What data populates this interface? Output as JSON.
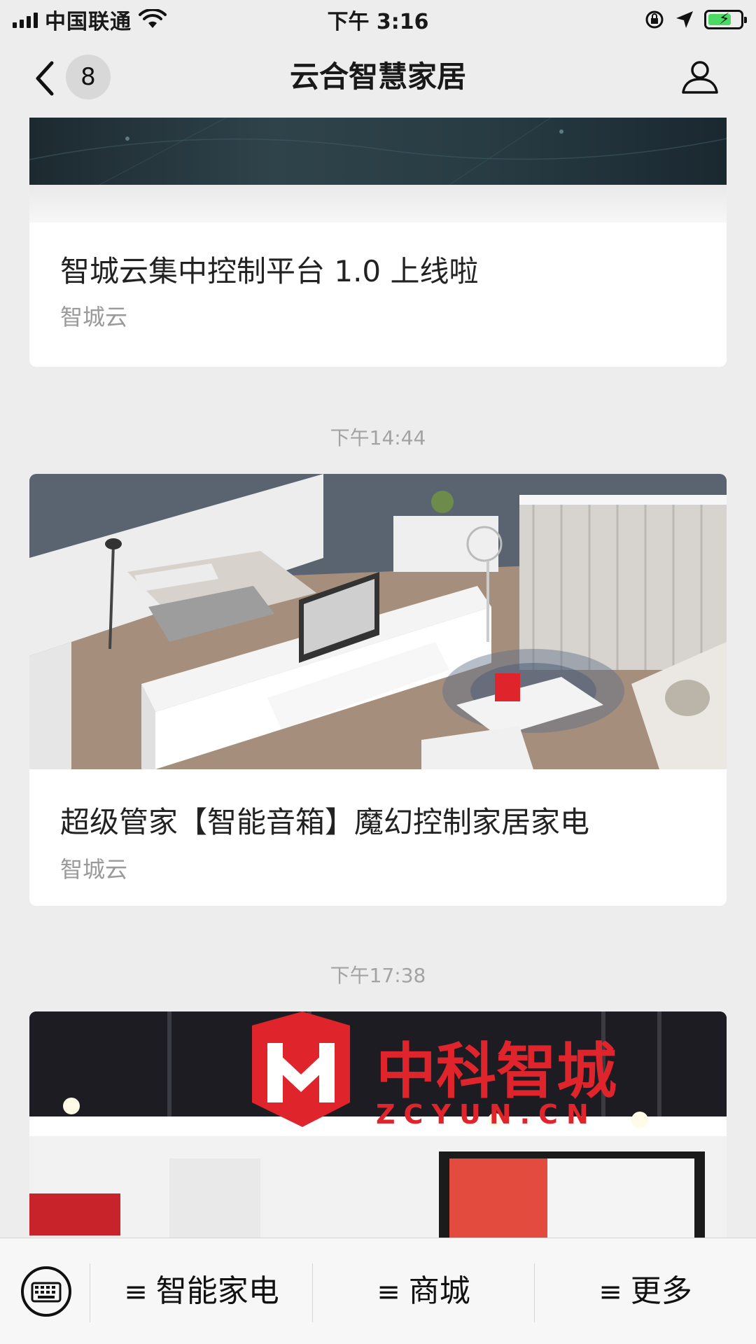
{
  "status_bar": {
    "carrier": "中国联通",
    "time": "下午 3:16"
  },
  "nav": {
    "title": "云合智慧家居",
    "badge_count": "8"
  },
  "articles": [
    {
      "title": "智城云集中控制平台 1.0 上线啦",
      "source": "智城云"
    },
    {
      "timestamp": "下午14:44",
      "title": "超级管家【智能音箱】魔幻控制家居家电",
      "source": "智城云"
    },
    {
      "timestamp": "下午17:38",
      "sign_text": "中科智城",
      "sign_sub": "ZCYUN.CN"
    }
  ],
  "menu": {
    "items": [
      "智能家电",
      "商城",
      "更多"
    ]
  },
  "colors": {
    "background": "#ededed",
    "battery_green": "#4cd964",
    "sign_red": "#e0242b"
  }
}
